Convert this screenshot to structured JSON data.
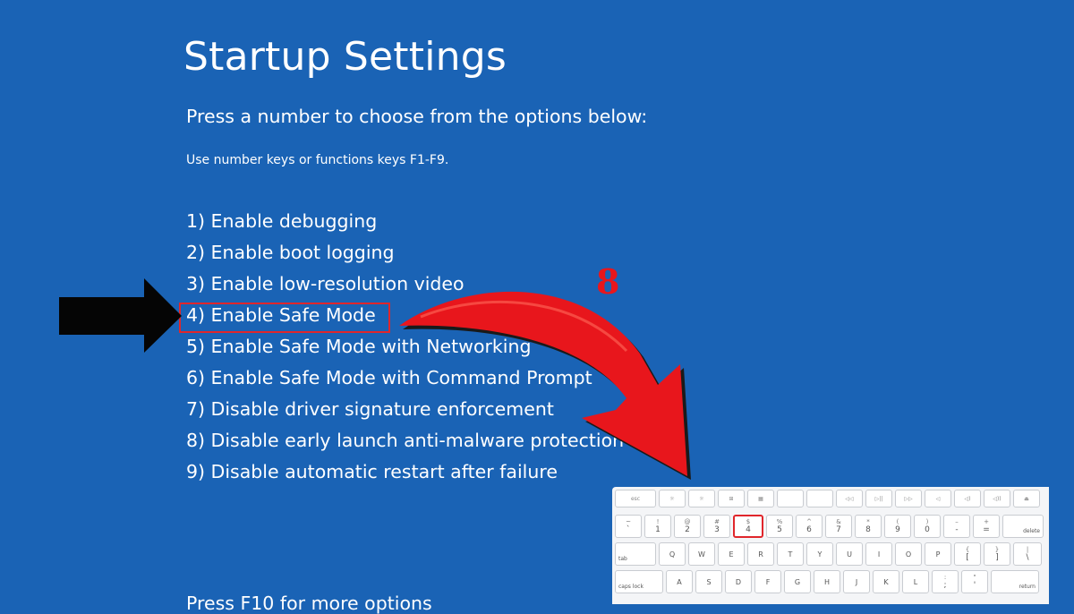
{
  "screen": {
    "title": "Startup Settings",
    "subtitle": "Press a number to choose from the options below:",
    "hint": "Use number keys or functions keys F1-F9.",
    "options": [
      "1) Enable debugging",
      "2) Enable boot logging",
      "3) Enable low-resolution video",
      "4) Enable Safe Mode",
      "5) Enable Safe Mode with Networking",
      "6) Enable Safe Mode with Command Prompt",
      "7) Disable driver signature enforcement",
      "8) Disable early launch anti-malware protection",
      "9) Disable automatic restart after failure"
    ],
    "footer": "Press F10 for more options"
  },
  "annotation": {
    "number": "8",
    "highlight_color": "#e0262b",
    "arrow_left_icon": "black-arrow-icon",
    "arrow_curved_icon": "red-curved-arrow-icon"
  },
  "keyboard": {
    "fn_row": [
      "esc",
      "☼",
      "☼",
      "⊞",
      "▦",
      "",
      "",
      "◁◁",
      "▷||",
      "▷▷",
      "◁",
      "◁)",
      "◁))",
      "⏏"
    ],
    "number_row": [
      {
        "top": "~",
        "bot": "`"
      },
      {
        "top": "!",
        "bot": "1"
      },
      {
        "top": "@",
        "bot": "2"
      },
      {
        "top": "#",
        "bot": "3"
      },
      {
        "top": "$",
        "bot": "4"
      },
      {
        "top": "%",
        "bot": "5"
      },
      {
        "top": "^",
        "bot": "6"
      },
      {
        "top": "&",
        "bot": "7"
      },
      {
        "top": "*",
        "bot": "8"
      },
      {
        "top": "(",
        "bot": "9"
      },
      {
        "top": ")",
        "bot": "0"
      },
      {
        "top": "–",
        "bot": "-"
      },
      {
        "top": "+",
        "bot": "="
      }
    ],
    "delete_label": "delete",
    "tab_label": "tab",
    "qwerty_row": [
      "Q",
      "W",
      "E",
      "R",
      "T",
      "Y",
      "U",
      "I",
      "O",
      "P"
    ],
    "qwerty_extra": [
      {
        "top": "{",
        "bot": "["
      },
      {
        "top": "}",
        "bot": "]"
      },
      {
        "top": "|",
        "bot": "\\"
      }
    ],
    "caps_label": "caps lock",
    "asdf_row": [
      "A",
      "S",
      "D",
      "F",
      "G",
      "H",
      "J",
      "K",
      "L"
    ],
    "asdf_extra": [
      {
        "top": ":",
        "bot": ";"
      },
      {
        "top": "\"",
        "bot": "'"
      }
    ],
    "return_label": "return",
    "selected_key": "4"
  }
}
